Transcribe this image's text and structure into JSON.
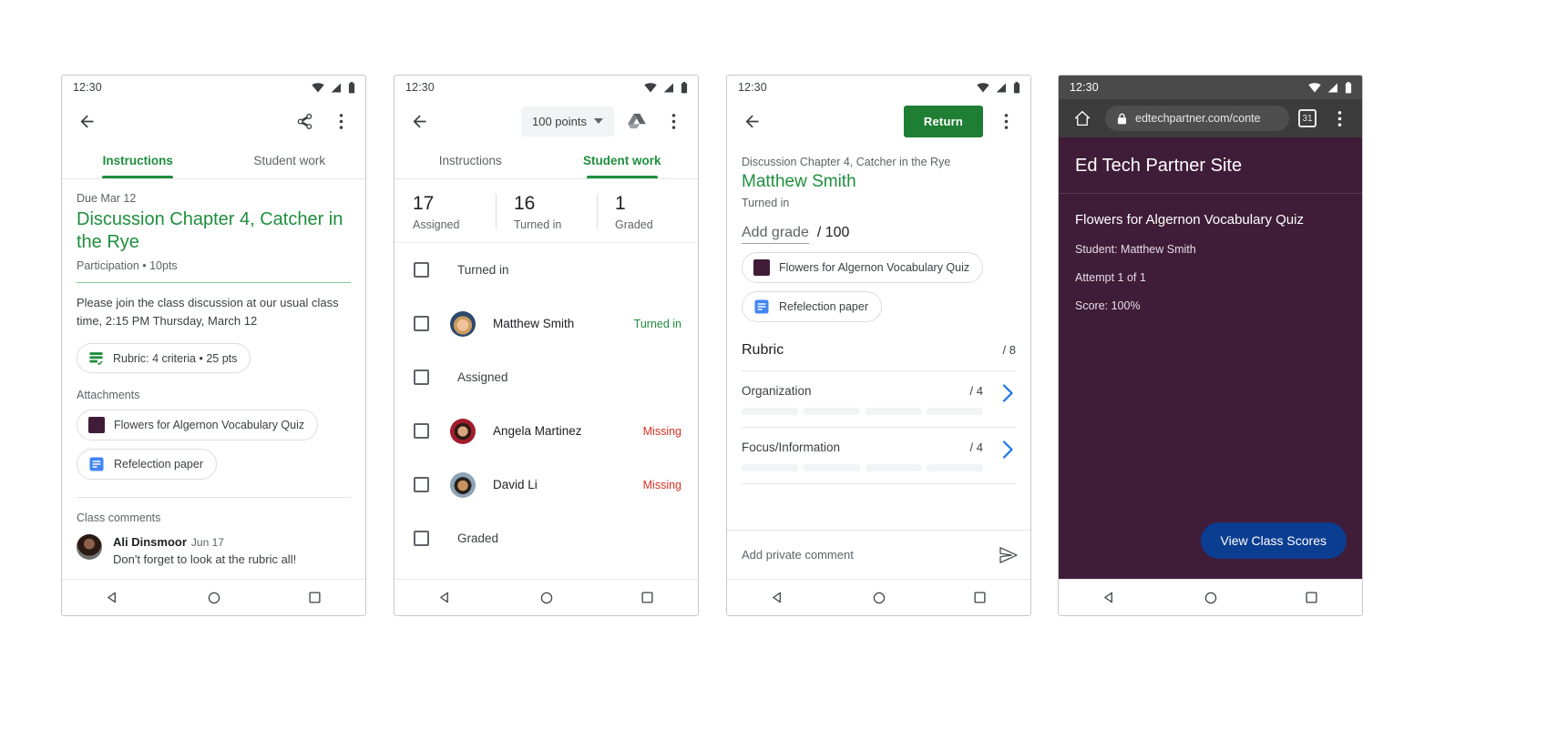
{
  "status_bar": {
    "time": "12:30"
  },
  "phone1": {
    "appbar": {
      "back": "back-arrow",
      "share": "share",
      "more": "more-options"
    },
    "tabs": [
      {
        "label": "Instructions",
        "active": true
      },
      {
        "label": "Student work",
        "active": false
      }
    ],
    "due": "Due Mar 12",
    "title": "Discussion Chapter 4, Catcher in the Rye",
    "submeta": "Participation • 10pts",
    "description": "Please join the class discussion at our usual class time, 2:15 PM Thursday, March 12",
    "rubric_chip": "Rubric: 4 criteria • 25 pts",
    "attachments_label": "Attachments",
    "attachments": [
      {
        "label": "Flowers for Algernon Vocabulary Quiz",
        "icon": "purple-square-icon"
      },
      {
        "label": "Refelection paper",
        "icon": "google-docs-icon"
      }
    ],
    "comments_label": "Class comments",
    "comments": [
      {
        "name": "Ali Dinsmoor",
        "date": "Jun 17",
        "text": "Don't forget to look at the rubric all!"
      }
    ]
  },
  "phone2": {
    "points_button": "100 points",
    "tabs": [
      {
        "label": "Instructions",
        "active": false
      },
      {
        "label": "Student work",
        "active": true
      }
    ],
    "stats": [
      {
        "num": "17",
        "label": "Assigned"
      },
      {
        "num": "16",
        "label": "Turned in"
      },
      {
        "num": "1",
        "label": "Graded"
      }
    ],
    "groups": [
      {
        "type": "header",
        "label": "Turned in"
      },
      {
        "type": "student",
        "name": "Matthew Smith",
        "status": "Turned in",
        "status_kind": "turned",
        "avatar": "av-matt"
      },
      {
        "type": "header",
        "label": "Assigned"
      },
      {
        "type": "student",
        "name": "Angela Martinez",
        "status": "Missing",
        "status_kind": "missing",
        "avatar": "av-angela"
      },
      {
        "type": "student",
        "name": "David Li",
        "status": "Missing",
        "status_kind": "missing",
        "avatar": "av-david"
      },
      {
        "type": "header",
        "label": "Graded"
      }
    ]
  },
  "phone3": {
    "return_button": "Return",
    "assignment": "Discussion Chapter 4, Catcher in the Rye",
    "student": "Matthew Smith",
    "state": "Turned in",
    "add_grade": "Add grade",
    "grade_max": "/ 100",
    "attachments": [
      {
        "label": "Flowers for Algernon Vocabulary Quiz",
        "icon": "purple-square-icon"
      },
      {
        "label": "Refelection paper",
        "icon": "google-docs-icon"
      }
    ],
    "rubric_title": "Rubric",
    "rubric_total": "/ 8",
    "criteria": [
      {
        "name": "Organization",
        "score": "/ 4",
        "levels": 4
      },
      {
        "name": "Focus/Information",
        "score": "/ 4",
        "levels": 4
      }
    ],
    "private_comment_placeholder": "Add private comment"
  },
  "phone4": {
    "url": "edtechpartner.com/conte",
    "tab_count": "31",
    "site_header": "Ed Tech Partner Site",
    "quiz_title": "Flowers for Algernon Vocabulary Quiz",
    "lines": [
      "Student: Matthew Smith",
      "Attempt 1 of 1",
      "Score: 100%"
    ],
    "cta": "View Class Scores"
  },
  "colors": {
    "green": "#1e8e3e",
    "return_green": "#1e7e34",
    "red": "#d93025",
    "purple": "#3f1d38",
    "blue": "#0b3d91",
    "docs_blue": "#4285f4"
  }
}
